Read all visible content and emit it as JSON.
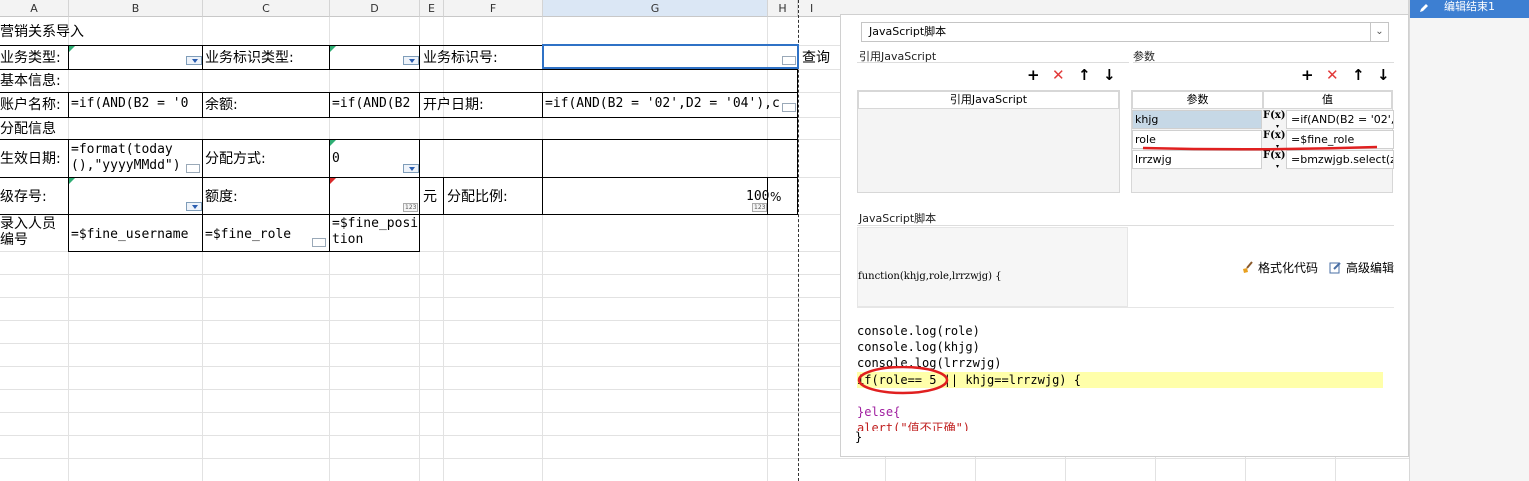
{
  "sheet": {
    "columns": [
      "A",
      "B",
      "C",
      "D",
      "E",
      "F",
      "G",
      "H",
      "I"
    ],
    "title": "营销关系导入",
    "cells": {
      "r2a": "业务类型:",
      "r2c": "业务标识类型:",
      "r2e": "业务标识号:",
      "r2query": "查询",
      "r3a": "基本信息:",
      "r4a": "账户名称:",
      "r4b": "=if(AND(B2 = '0",
      "r4c": "余额:",
      "r4d": "=if(AND(B2",
      "r4e": "开户日期:",
      "r4g": "=if(AND(B2 = '02',D2 = '04'),c",
      "r5a": "分配信息",
      "r6a": "生效日期:",
      "r6b": "=format(today(),\"yyyyMMdd\")",
      "r6c": "分配方式:",
      "r6d": "0",
      "r7a": "级存号:",
      "r7c": "额度:",
      "r7e": "元",
      "r7f": "分配比例:",
      "r7g": "100",
      "r7h": "%",
      "r8a": "录入人员编号",
      "r8b": "=$fine_username",
      "r8c": "=$fine_role",
      "r8d": "=$fine_position",
      "num_badge": "123"
    }
  },
  "dialog": {
    "selected_script": "JavaScript脚本",
    "ref_section_label": "引用JavaScript",
    "param_section_label": "参数",
    "ref_table_header": "引用JavaScript",
    "param_header_name": "参数",
    "param_header_value": "值",
    "params": [
      {
        "name": "khjg",
        "value": "=if(AND(B2 = '02',D"
      },
      {
        "name": "role",
        "value": "=$fine_role"
      },
      {
        "name": "lrrzwjg",
        "value": "=bmzwjgb.select(z"
      }
    ],
    "fx_label": "F(x)",
    "script_section_label": "JavaScript脚本",
    "function_signature": "function(khjg,role,lrrzwjg) {",
    "format_code": "格式化代码",
    "advanced_edit": "高级编辑",
    "code_lines": [
      "console.log(role)",
      "console.log(khjg)",
      "console.log(lrrzwjg)",
      "if(role== 5 || khjg==lrrzwjg) {",
      "",
      "}else{",
      "alert(\"值不正确\")"
    ],
    "closing_brace": "}",
    "toolbar_icons": [
      "add-icon",
      "delete-icon",
      "move-up-icon",
      "move-down-icon"
    ],
    "delete_color": "#e23a3a",
    "highlight_color": "#ffffaa",
    "annotation_color": "#e02020"
  },
  "sidebar": {
    "button_label": "编辑结束1",
    "button_color": "#3d7fd2"
  }
}
